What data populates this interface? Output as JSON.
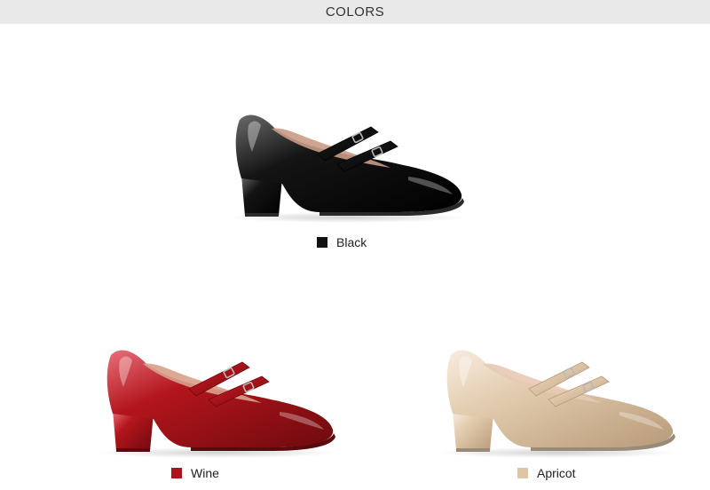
{
  "header": {
    "title": "COLORS"
  },
  "variants": [
    {
      "id": "black",
      "label": "Black",
      "swatch": "#111111",
      "body": "#141414",
      "shade": "#000000",
      "highlight": "#6a6a6a",
      "lining": "#c99a86",
      "sole": "#2a2a2a"
    },
    {
      "id": "wine",
      "label": "Wine",
      "swatch": "#a8141b",
      "body": "#b3151c",
      "shade": "#6e0a0e",
      "highlight": "#e8707a",
      "lining": "#d9a08c",
      "sole": "#5a0a0c"
    },
    {
      "id": "apricot",
      "label": "Apricot",
      "swatch": "#dcc6a6",
      "body": "#e3cdb0",
      "shade": "#b89a78",
      "highlight": "#f8ece0",
      "lining": "#e8c9b4",
      "sole": "#9a8a78"
    }
  ]
}
